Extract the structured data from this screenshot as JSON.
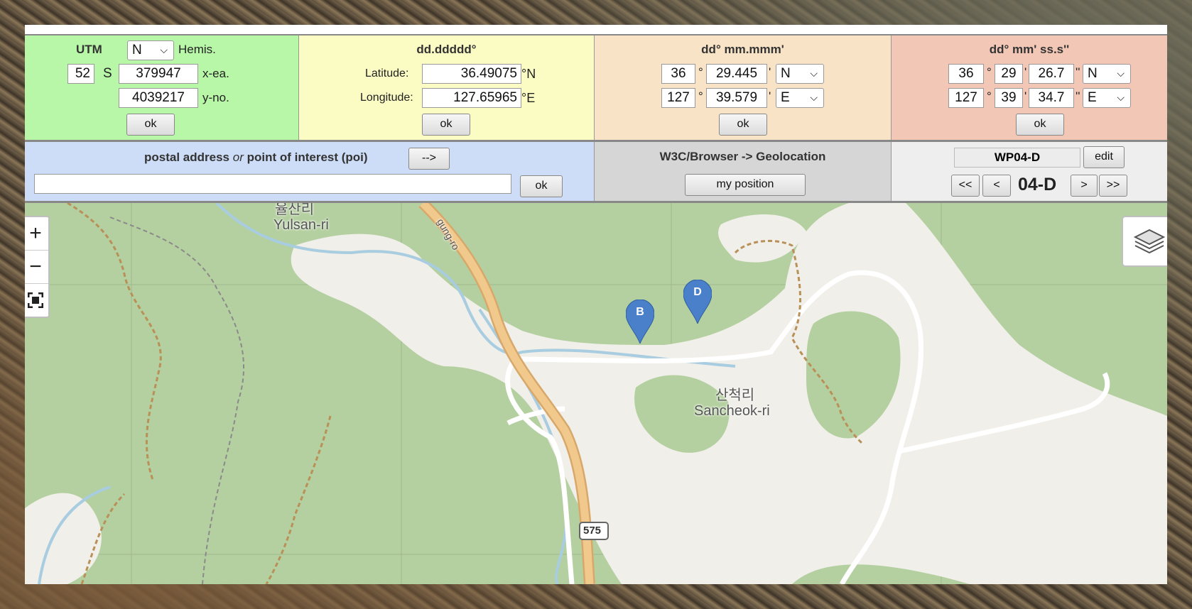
{
  "utm": {
    "title": "UTM",
    "hemis_value": "N",
    "hemis_label": "Hemis.",
    "zone": "52",
    "band": "S",
    "easting": "379947",
    "easting_label": "x-ea.",
    "northing": "4039217",
    "northing_label": "y-no.",
    "ok": "ok"
  },
  "dd": {
    "title": "dd.ddddd°",
    "lat_label": "Latitude:",
    "lat": "36.49075",
    "lat_unit": "°N",
    "lon_label": "Longitude:",
    "lon": "127.65965",
    "lon_unit": "°E",
    "ok": "ok"
  },
  "dm": {
    "title": "dd° mm.mmm'",
    "lat_deg": "36",
    "lat_min": "29.445",
    "lat_dir": "N",
    "lon_deg": "127",
    "lon_min": "39.579",
    "lon_dir": "E",
    "deg_sym": "°",
    "min_sym": "'",
    "ok": "ok"
  },
  "dms": {
    "title": "dd° mm' ss.s''",
    "lat_deg": "36",
    "lat_min": "29",
    "lat_sec": "26.7",
    "lat_dir": "N",
    "lon_deg": "127",
    "lon_min": "39",
    "lon_sec": "34.7",
    "lon_dir": "E",
    "deg_sym": "°",
    "min_sym": "'",
    "sec_sym": "''",
    "ok": "ok"
  },
  "address": {
    "title_a": "postal address",
    "title_or": "or",
    "title_b": "point of interest (poi)",
    "arrow_button": "-->",
    "input_value": "",
    "ok": "ok"
  },
  "geo": {
    "title": "W3C/Browser -> Geolocation",
    "button": "my position"
  },
  "waypoint": {
    "name": "WP04-D",
    "edit": "edit",
    "first": "<<",
    "prev": "<",
    "current": "04-D",
    "next": ">",
    "last": ">>"
  },
  "map": {
    "zoom_in": "+",
    "zoom_out": "−",
    "place1_ko": "율산리",
    "place1_en": "Yulsan-ri",
    "place2_ko": "산척리",
    "place2_en": "Sancheok-ri",
    "road_name": "gung-ro",
    "route_shield": "575",
    "marker_b": "B",
    "marker_d": "D"
  },
  "colors": {
    "forest": "#b5d0a0",
    "clearing": "#f0efe9",
    "road_major": "#f2c98c",
    "marker": "#4a7fc9"
  }
}
